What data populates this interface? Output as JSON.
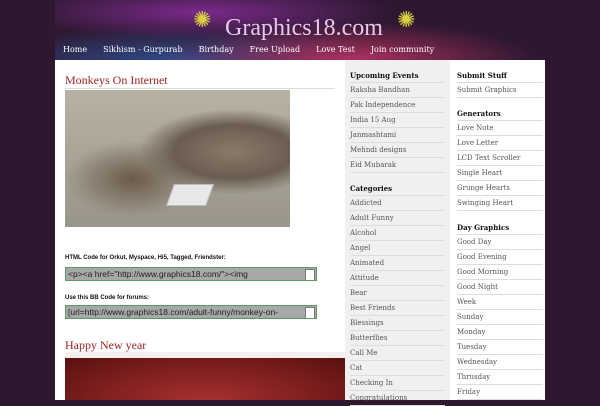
{
  "header": {
    "logo": "Graphics18.com",
    "nav": [
      "Home",
      "Sikhism - Gurpurab",
      "Birthday",
      "Free Upload",
      "Love Test",
      "Join community"
    ]
  },
  "main": {
    "post_title": "Monkeys On Internet",
    "html_label": "HTML Code for Orkut, Myspace, Hi5, Tagged, Friendster:",
    "html_code": "<p><a href=\"http://www.graphics18.com/\"><img",
    "bb_label": "Use this BB Code for forums:",
    "bb_code": "[url=http://www.graphics18.com/adult-funny/monkey-on-",
    "post2_title": "Happy New year"
  },
  "side1": {
    "events_title": "Upcoming Events",
    "events": [
      "Raksha Bandhan",
      "Pak Independence",
      "India 15 Aug",
      "Janmashtami",
      "Mehndi designs",
      "Eid Mubarak"
    ],
    "categories_title": "Categories",
    "categories": [
      "Addicted",
      "Adult Funny",
      "Alcohol",
      "Angel",
      "Animated",
      "Attitude",
      "Bear",
      "Best Friends",
      "Blessings",
      "Butterflies",
      "Call Me",
      "Cat",
      "Checking In",
      "Congratulations"
    ]
  },
  "side2": {
    "submit_title": "Submit Stuff",
    "submit": [
      "Submit Graphics"
    ],
    "generators_title": "Generators",
    "generators": [
      "Love Note",
      "Love Letter",
      "LCD Text Scroller",
      "Single Heart",
      "Grunge Hearts",
      "Swinging Heart"
    ],
    "day_title": "Day Graphics",
    "day": [
      "Good Day",
      "Good Evening",
      "Good Morning",
      "Good Night",
      "Week",
      "Sunday",
      "Monday",
      "Tuesday",
      "Wednesday",
      "Thrusday",
      "Friday"
    ]
  }
}
